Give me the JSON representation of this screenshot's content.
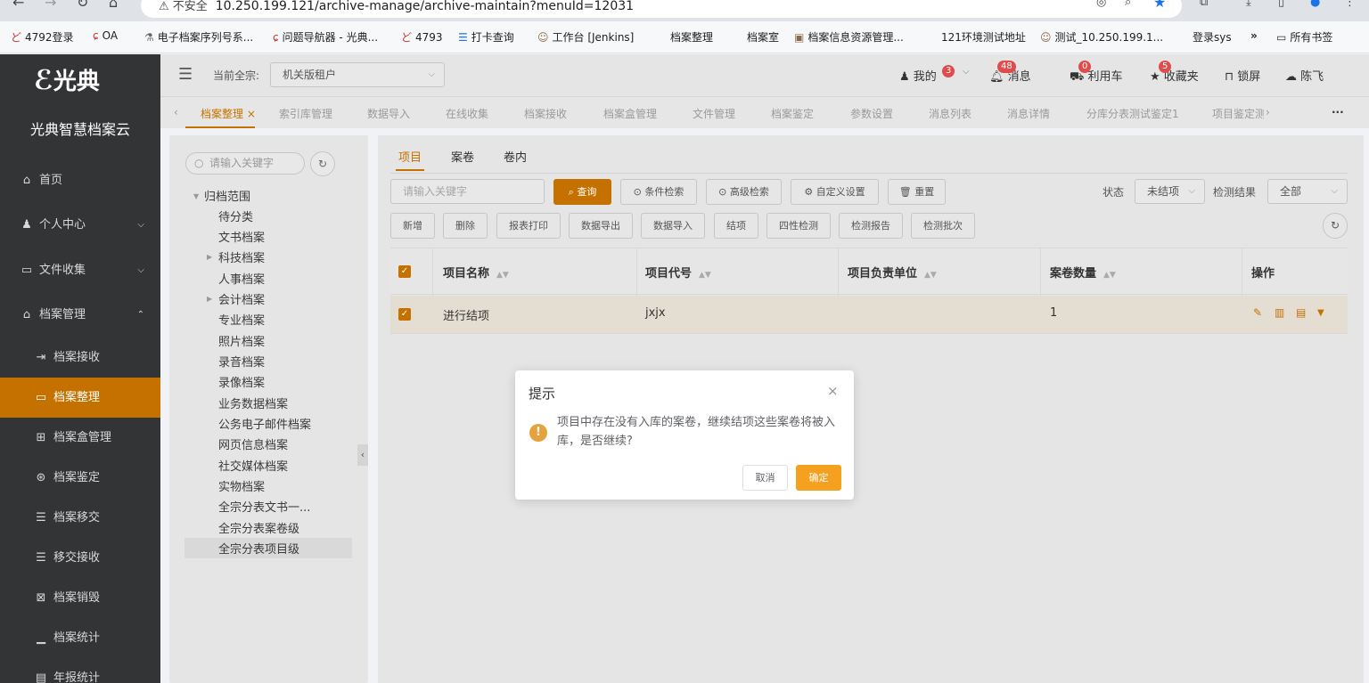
{
  "browser": {
    "security_label": "不安全",
    "url": "10.250.199.121/archive-manage/archive-maintain?menuId=12031",
    "bookmarks": [
      "4792登录",
      "OA",
      "电子档案序列号系...",
      "问题导航器 - 光典...",
      "4793",
      "打卡查询",
      "工作台 [Jenkins]",
      "档案整理",
      "档案室",
      "档案信息资源管理...",
      "121环境测试地址",
      "测试_10.250.199.1...",
      "登录sys",
      "»",
      "所有书签"
    ]
  },
  "sidebar": {
    "logo": "光典",
    "product_name": "光典智慧档案云",
    "items": [
      {
        "label": "首页",
        "icon": "home-icon"
      },
      {
        "label": "个人中心",
        "icon": "user-icon"
      },
      {
        "label": "文件收集",
        "icon": "folder-icon"
      },
      {
        "label": "档案管理",
        "icon": "bank-icon"
      },
      {
        "label": "档案接收",
        "icon": "import-icon"
      },
      {
        "label": "档案整理",
        "icon": "folder-open-icon"
      },
      {
        "label": "档案盒管理",
        "icon": "box-icon"
      },
      {
        "label": "档案鉴定",
        "icon": "compass-icon"
      },
      {
        "label": "档案移交",
        "icon": "list-icon"
      },
      {
        "label": "移交接收",
        "icon": "list-icon"
      },
      {
        "label": "档案销毁",
        "icon": "destroy-icon"
      },
      {
        "label": "档案统计",
        "icon": "chart-icon"
      },
      {
        "label": "年报统计",
        "icon": "report-icon"
      }
    ]
  },
  "header": {
    "current_label": "当前全宗:",
    "current_value": "机关版租户",
    "mine": "我的",
    "mine_badge": "3",
    "messages": "消息",
    "messages_badge": "48",
    "cart": "利用车",
    "cart_badge": "0",
    "favorites": "收藏夹",
    "favorites_badge": "5",
    "lock": "锁屏",
    "user": "陈飞"
  },
  "tabs": [
    "档案整理",
    "索引库管理",
    "数据导入",
    "在线收集",
    "档案接收",
    "档案盒管理",
    "文件管理",
    "档案鉴定",
    "参数设置",
    "消息列表",
    "消息详情",
    "分库分表测试鉴定1",
    "项目鉴定测"
  ],
  "tree": {
    "search_placeholder": "请输入关键字",
    "root": "归档范围",
    "nodes": [
      "待分类",
      "文书档案",
      "科技档案",
      "人事档案",
      "会计档案",
      "专业档案",
      "照片档案",
      "录音档案",
      "录像档案",
      "业务数据档案",
      "公务电子邮件档案",
      "网页信息档案",
      "社交媒体档案",
      "实物档案",
      "全宗分表文书一...",
      "全宗分表案卷级",
      "全宗分表项目级"
    ]
  },
  "main": {
    "tabs": [
      "项目",
      "案卷",
      "卷内"
    ],
    "search_placeholder": "请输入关键字",
    "query": "查询",
    "condition_search": "条件检索",
    "advanced_search": "高级检索",
    "custom_settings": "自定义设置",
    "reset": "重置",
    "status_label": "状态",
    "status_value": "未结项",
    "check_result_label": "检测结果",
    "check_result_value": "全部",
    "actions": [
      "新增",
      "删除",
      "报表打印",
      "数据导出",
      "数据导入",
      "结项",
      "四性检测",
      "检测报告",
      "检测批次"
    ],
    "columns": [
      "项目名称",
      "项目代号",
      "项目负责单位",
      "案卷数量",
      "操作"
    ],
    "rows": [
      {
        "name": "进行结项",
        "code": "jxjx",
        "unit": "",
        "count": "1"
      }
    ]
  },
  "dialog": {
    "title": "提示",
    "message": "项目中存在没有入库的案卷，继续结项这些案卷将被入库，是否继续?",
    "cancel": "取消",
    "confirm": "确定"
  }
}
